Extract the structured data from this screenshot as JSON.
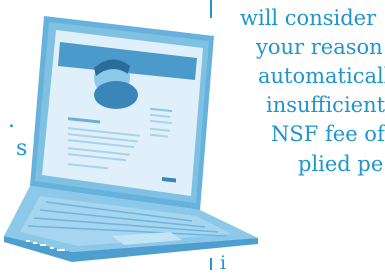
{
  "right_text": {
    "lines": [
      "will consider",
      "your reason",
      "automaticall",
      "insufficient",
      "NSF fee of",
      "plied pe"
    ]
  },
  "left_text": {
    "fragment": "s"
  },
  "colors": {
    "accent": "#1e95cc",
    "laptop_body": "#7fc1e3",
    "screen": "#e7f3fa",
    "bezel": "#5aa8d3"
  },
  "icons": {
    "laptop": "laptop-icon"
  }
}
